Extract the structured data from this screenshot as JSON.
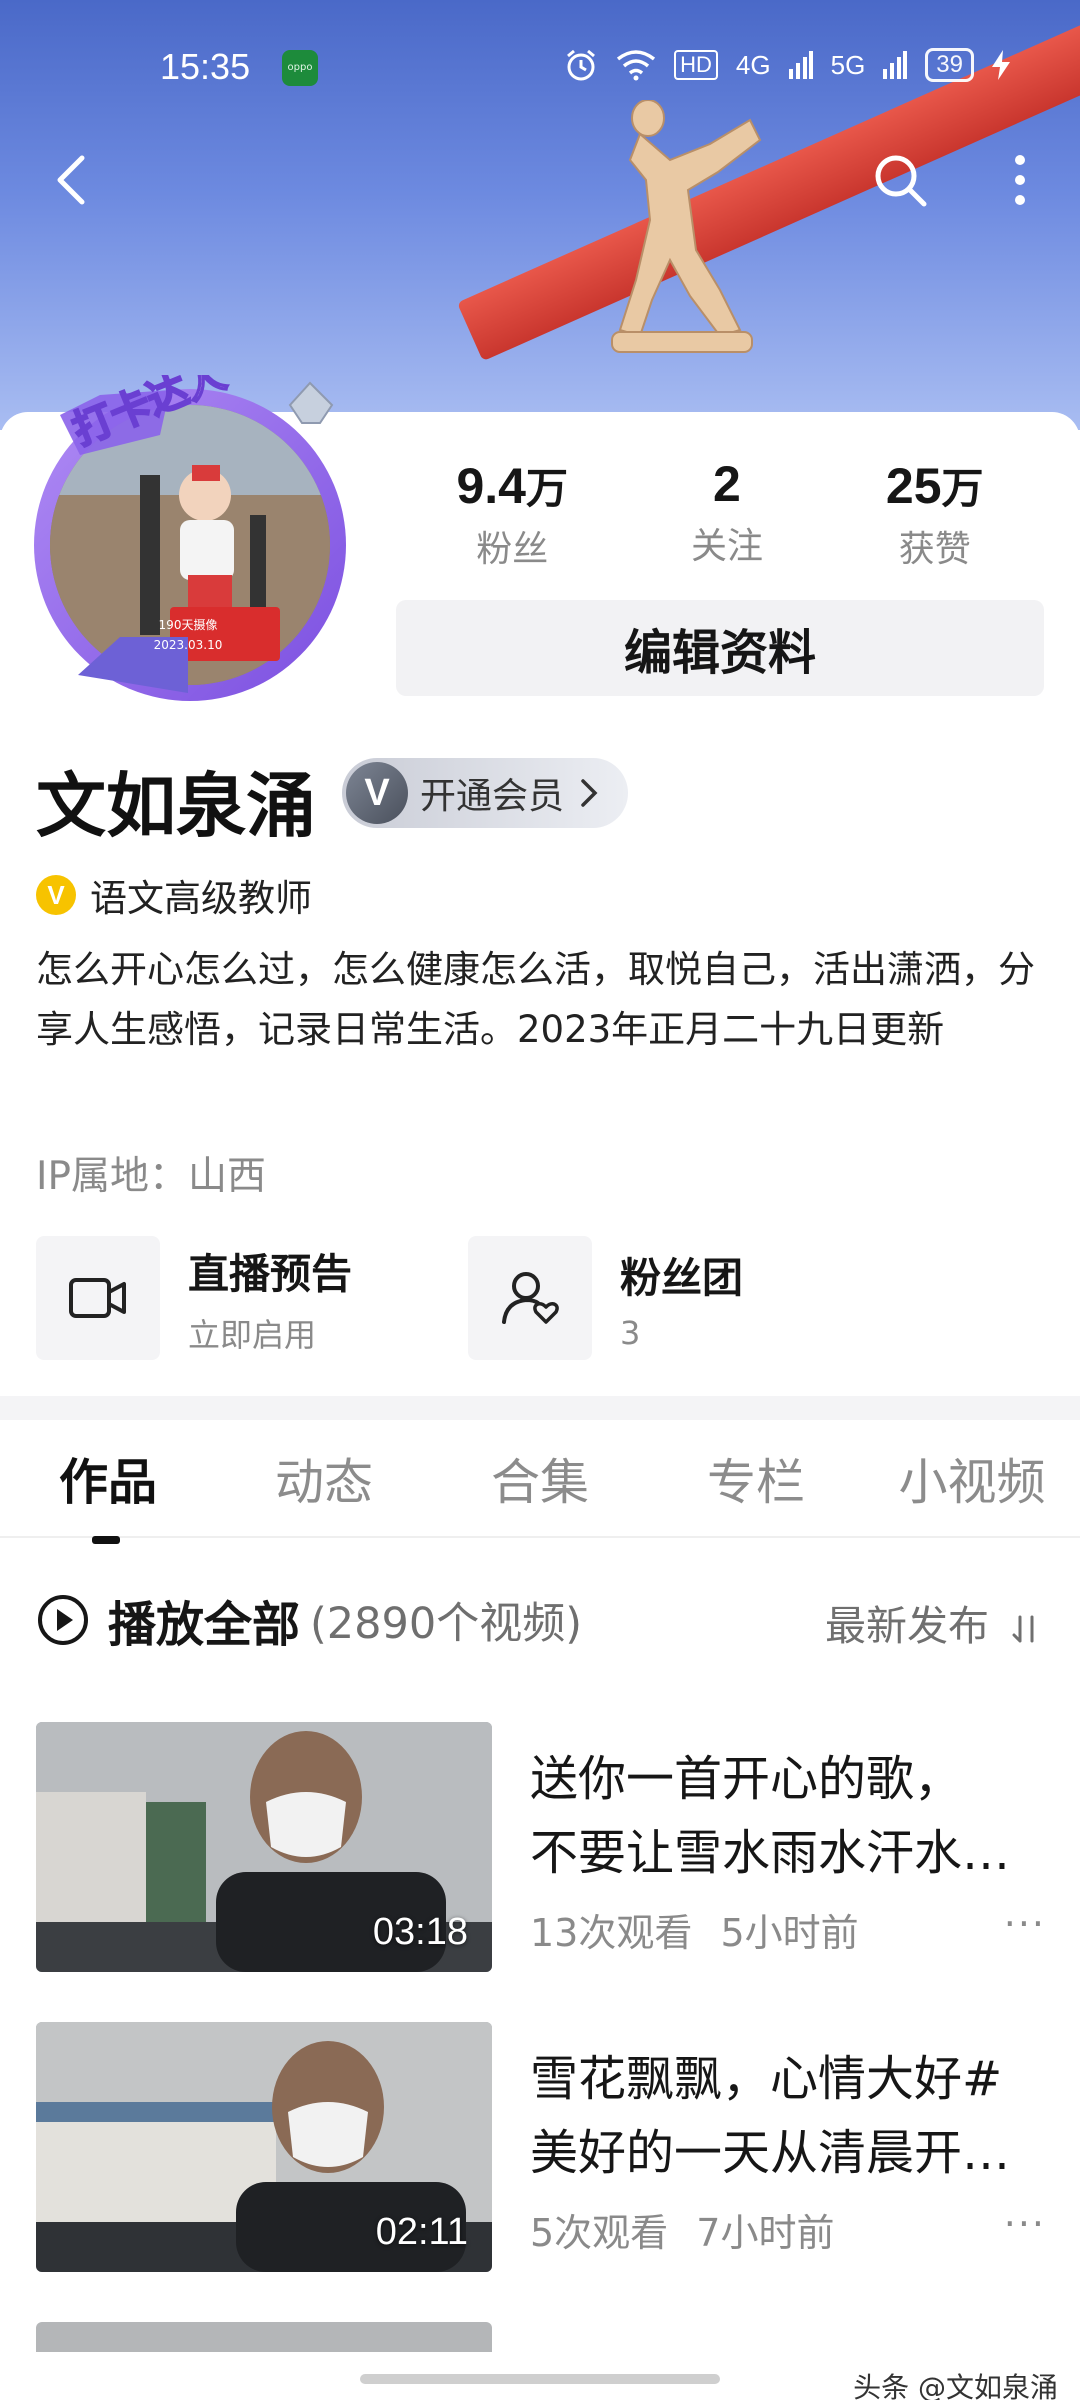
{
  "status_bar": {
    "time": "15:35",
    "app_badge": "oppo",
    "network_1": "HD",
    "network_2": "4G",
    "network_3": "5G",
    "battery": "39"
  },
  "header": {
    "back_icon": "chevron-left-icon",
    "search_icon": "search-icon",
    "more_icon": "more-vertical-icon"
  },
  "avatar": {
    "badge_text": "打卡达人",
    "sticker_line1": "190天摄像",
    "sticker_line2": "2023.03.10"
  },
  "stats": [
    {
      "value": "9.4",
      "unit": "万",
      "label": "粉丝"
    },
    {
      "value": "2",
      "unit": "",
      "label": "关注"
    },
    {
      "value": "25",
      "unit": "万",
      "label": "获赞"
    }
  ],
  "edit_button": "编辑资料",
  "profile": {
    "name": "文如泉涌",
    "vip_icon": "V",
    "vip_label": "开通会员",
    "verify_icon": "V",
    "verify_text": "语文高级教师",
    "bio": "怎么开心怎么过，怎么健康怎么活，取悦自己，活出潇洒，分享人生感悟，记录日常生活。2023年正月二十九日更新",
    "ip": "IP属地：山西"
  },
  "quick_actions": [
    {
      "icon": "video-camera-icon",
      "title": "直播预告",
      "sub": "立即启用"
    },
    {
      "icon": "fan-group-icon",
      "title": "粉丝团",
      "sub": "3"
    }
  ],
  "tabs": [
    "作品",
    "动态",
    "合集",
    "专栏",
    "小视频"
  ],
  "active_tab": "作品",
  "play_all": {
    "label": "播放全部",
    "count": "(2890个视频)",
    "sort": "最新发布"
  },
  "videos": [
    {
      "line1": "送你一首开心的歌，",
      "line2": "不要让雪水雨水汗水…",
      "duration": "03:18",
      "views": "13次观看",
      "time": "5小时前",
      "more": "···"
    },
    {
      "line1": "雪花飘飘，心情大好#",
      "line2": "美好的一天从清晨开…",
      "duration": "02:11",
      "views": "5次观看",
      "time": "7小时前",
      "more": "···"
    }
  ],
  "watermark": "头条 @文如泉涌"
}
